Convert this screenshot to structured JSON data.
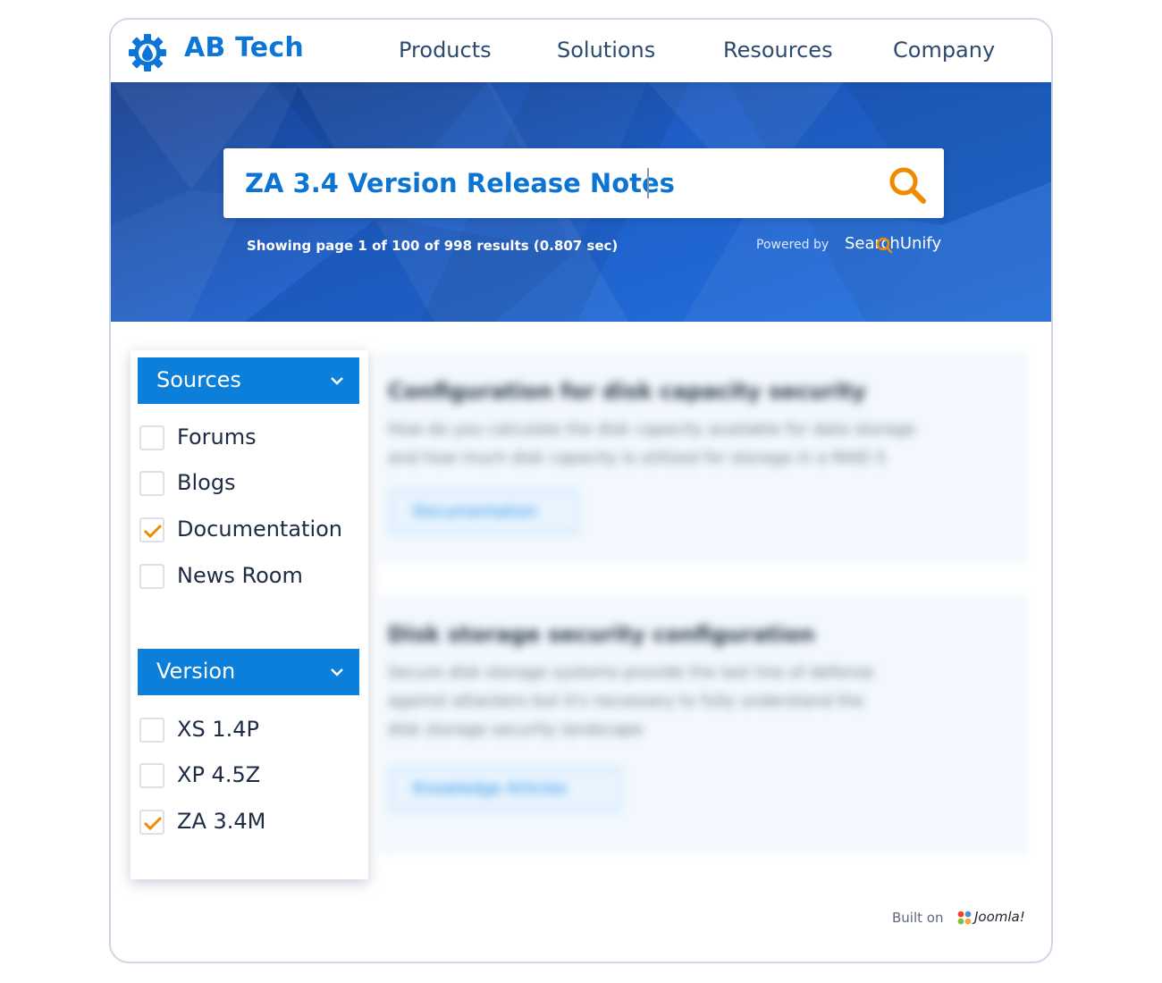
{
  "navbar": {
    "brand": "AB Tech",
    "logo_icon": "gear-drop-icon",
    "items": [
      {
        "label": "Products"
      },
      {
        "label": "Solutions"
      },
      {
        "label": "Resources"
      },
      {
        "label": "Company"
      }
    ]
  },
  "search": {
    "query": "ZA 3.4 Version Release Notes",
    "icon": "search-icon",
    "results_text": "Showing page 1 of 100 of 998 results (0.807 sec)",
    "powered_by": "Powered by",
    "powered_brand": "SearchUnify"
  },
  "filters": {
    "sources": {
      "title": "Sources",
      "options": [
        {
          "label": "Forums",
          "checked": false
        },
        {
          "label": "Blogs",
          "checked": false
        },
        {
          "label": "Documentation",
          "checked": true
        },
        {
          "label": "News Room",
          "checked": false
        }
      ]
    },
    "version": {
      "title": "Version",
      "options": [
        {
          "label": "XS 1.4P",
          "checked": false
        },
        {
          "label": "XP 4.5Z",
          "checked": false
        },
        {
          "label": "ZA 3.4M",
          "checked": true
        }
      ]
    }
  },
  "results": [
    {
      "title": "Configuration for disk capacity security",
      "lines": [
        "How do you calculate the disk capacity available for data storage",
        "and how much disk capacity is utilized for storage in a RAID 5"
      ],
      "tag": "Documentation"
    },
    {
      "title": "Disk storage security configuration",
      "lines": [
        "Secure disk storage systems provide the last line of defense",
        "against attackers but it's necessary to fully understand the",
        "disk storage security landscape"
      ],
      "tag": "Knowledge Articles"
    }
  ],
  "footer": {
    "built_on": "Built on",
    "platform": "Joomla!"
  },
  "colors": {
    "brand_blue": "#0b76d6",
    "filter_header": "#0b7fd9",
    "accent_orange": "#f08a00",
    "nav_text": "#2b4a6e"
  }
}
